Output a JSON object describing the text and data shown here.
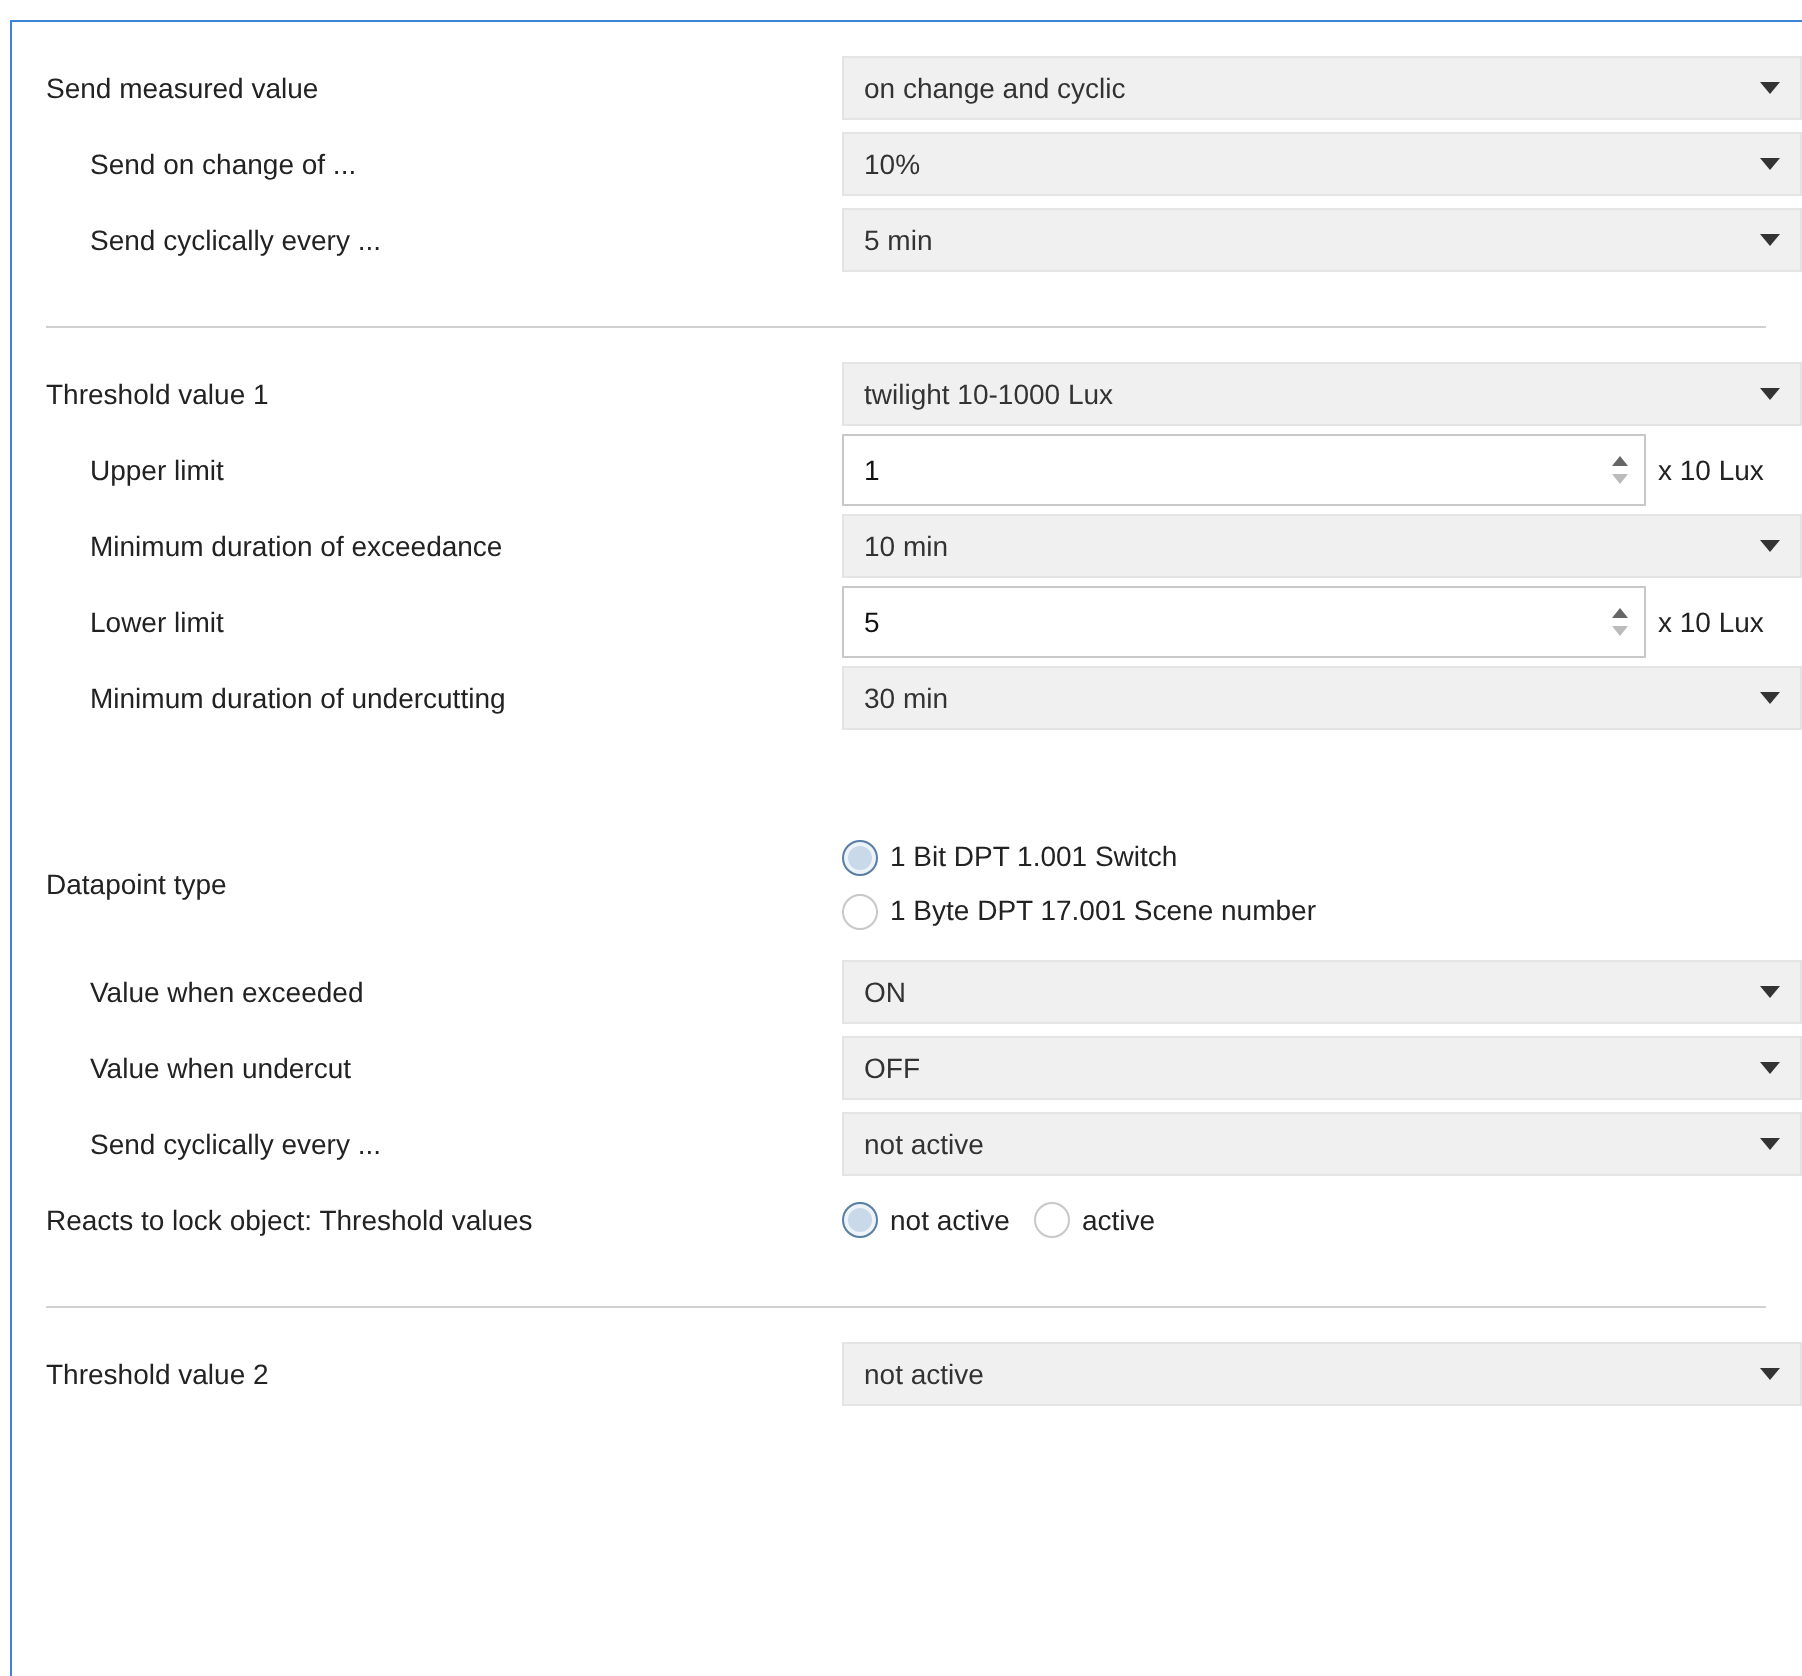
{
  "sections": [
    {
      "rows": [
        {
          "kind": "dropdown",
          "label": "Send measured value",
          "indented": false,
          "value": "on change and cyclic"
        },
        {
          "kind": "dropdown",
          "label": "Send on change of ...",
          "indented": true,
          "value": "10%"
        },
        {
          "kind": "dropdown",
          "label": "Send cyclically every ...",
          "indented": true,
          "value": "5 min"
        }
      ]
    },
    {
      "rows": [
        {
          "kind": "dropdown",
          "label": "Threshold value 1",
          "indented": false,
          "value": "twilight 10-1000 Lux"
        },
        {
          "kind": "spin",
          "label": "Upper limit",
          "indented": true,
          "value": "1",
          "unit": "x 10 Lux"
        },
        {
          "kind": "dropdown",
          "label": "Minimum duration of exceedance",
          "indented": true,
          "value": "10 min"
        },
        {
          "kind": "spin",
          "label": "Lower limit",
          "indented": true,
          "value": "5",
          "unit": "x 10 Lux"
        },
        {
          "kind": "dropdown",
          "label": "Minimum duration of undercutting",
          "indented": true,
          "value": "30 min"
        },
        {
          "kind": "radio",
          "label": "Datapoint type",
          "indented": false,
          "inline": false,
          "options": [
            {
              "label": "1 Bit DPT 1.001 Switch",
              "selected": true
            },
            {
              "label": "1 Byte DPT 17.001 Scene number",
              "selected": false
            }
          ]
        },
        {
          "kind": "dropdown",
          "label": "Value when exceeded",
          "indented": true,
          "value": "ON"
        },
        {
          "kind": "dropdown",
          "label": "Value when undercut",
          "indented": true,
          "value": "OFF"
        },
        {
          "kind": "dropdown",
          "label": "Send cyclically every ...",
          "indented": true,
          "value": "not active"
        },
        {
          "kind": "radio",
          "label": "Reacts to lock object: Threshold values",
          "indented": false,
          "inline": true,
          "options": [
            {
              "label": "not active",
              "selected": true
            },
            {
              "label": "active",
              "selected": false
            }
          ]
        }
      ]
    },
    {
      "rows": [
        {
          "kind": "dropdown",
          "label": "Threshold value 2",
          "indented": false,
          "value": "not active"
        }
      ]
    }
  ]
}
